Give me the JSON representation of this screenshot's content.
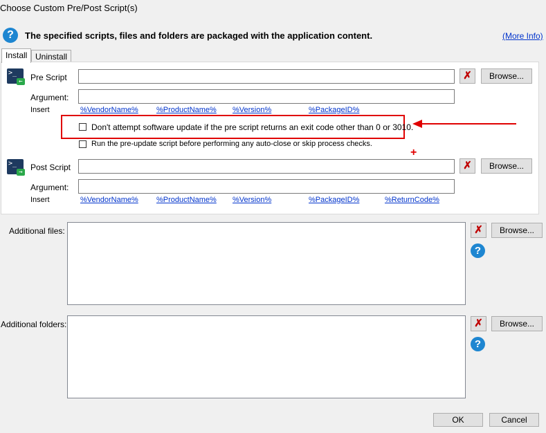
{
  "window": {
    "title": "Choose Custom Pre/Post Script(s)"
  },
  "header": {
    "text": "The specified scripts, files and folders are packaged with the application content.",
    "more_info": "(More Info)"
  },
  "tabs": [
    {
      "label": "Install",
      "active": true
    },
    {
      "label": "Uninstall",
      "active": false
    }
  ],
  "pre_script": {
    "label": "Pre Script",
    "value": "",
    "argument_label": "Argument:",
    "argument_value": "",
    "insert_label": "Insert",
    "variables": [
      "%VendorName%",
      "%ProductName%",
      "%Version%",
      "%PackageID%"
    ],
    "checkbox_exit_code": {
      "label": "Don't attempt software update if the pre script returns an exit code other than 0 or 3010.",
      "checked": false
    },
    "checkbox_pre_update": {
      "label": "Run the pre-update script before performing any auto-close or skip process checks.",
      "checked": false
    }
  },
  "post_script": {
    "label": "Post Script",
    "value": "",
    "argument_label": "Argument:",
    "argument_value": "",
    "insert_label": "Insert",
    "variables": [
      "%VendorName%",
      "%ProductName%",
      "%Version%",
      "%PackageID%",
      "%ReturnCode%"
    ]
  },
  "buttons": {
    "browse": "Browse...",
    "clear_glyph": "✗",
    "ok": "OK",
    "cancel": "Cancel"
  },
  "additional_files": {
    "label": "Additional files:"
  },
  "additional_folders": {
    "label": "Additional folders:"
  },
  "icons": {
    "question": "?",
    "terminal": ">_",
    "annotation_plus": "+"
  },
  "colors": {
    "accent_blue": "#1e86d1",
    "annotation_red": "#e00000",
    "link_blue": "#0033cc"
  }
}
